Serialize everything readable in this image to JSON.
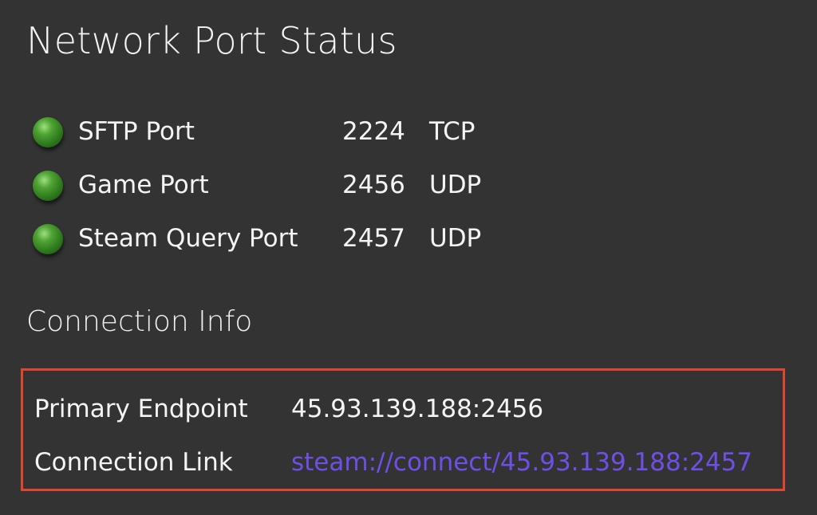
{
  "page": {
    "title": "Network Port Status"
  },
  "ports": [
    {
      "name": "SFTP Port",
      "number": "2224",
      "protocol": "TCP",
      "status": "up",
      "status_color": "#4fa334"
    },
    {
      "name": "Game Port",
      "number": "2456",
      "protocol": "UDP",
      "status": "up",
      "status_color": "#4fa334"
    },
    {
      "name": "Steam Query Port",
      "number": "2457",
      "protocol": "UDP",
      "status": "up",
      "status_color": "#4fa334"
    }
  ],
  "connection": {
    "title": "Connection Info",
    "endpoint_label": "Primary Endpoint",
    "endpoint_value": "45.93.139.188:2456",
    "link_label": "Connection Link",
    "link_value": "steam://connect/45.93.139.188:2457",
    "highlight_color": "#e0462e",
    "link_color": "#6f4fe6"
  }
}
